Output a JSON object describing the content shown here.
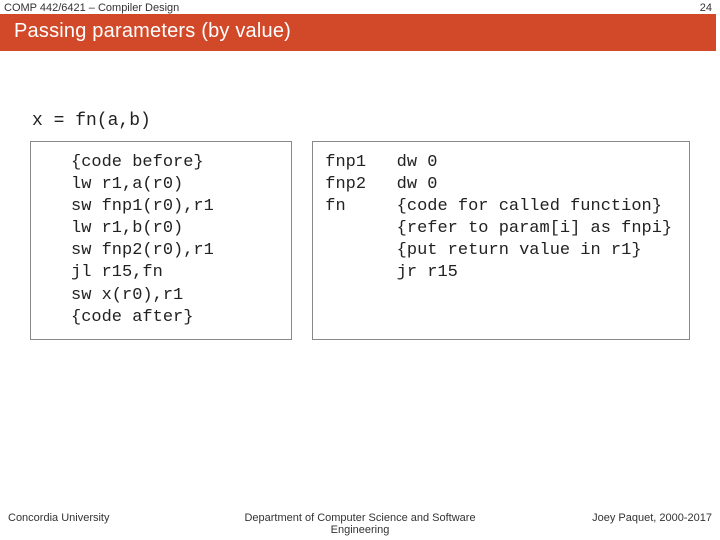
{
  "header": {
    "course": "COMP 442/6421 – Compiler Design",
    "slide_number": "24",
    "title": "Passing parameters (by value)"
  },
  "call_expression": "x = fn(a,b)",
  "code_left": "{code before}\nlw r1,a(r0)\nsw fnp1(r0),r1\nlw r1,b(r0)\nsw fnp2(r0),r1\njl r15,fn\nsw x(r0),r1\n{code after}",
  "code_right": "fnp1   dw 0\nfnp2   dw 0\nfn     {code for called function}\n       {refer to param[i] as fnpi}\n       {put return value in r1}\n       jr r15",
  "footer": {
    "left": "Concordia University",
    "center": "Department of Computer Science and Software Engineering",
    "right": "Joey Paquet, 2000-2017"
  }
}
